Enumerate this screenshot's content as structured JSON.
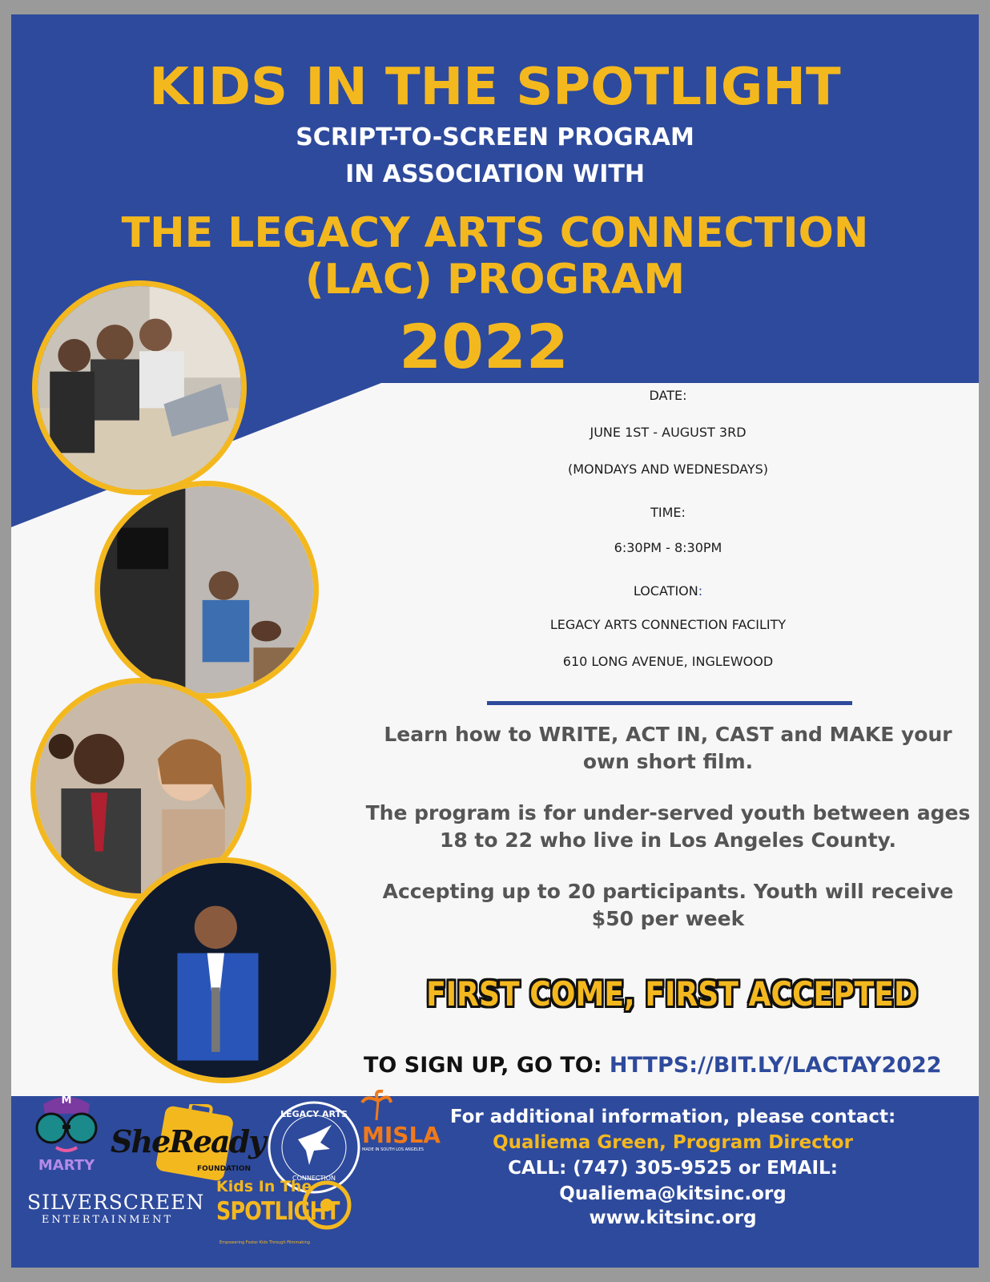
{
  "header": {
    "title": "KIDS IN THE SPOTLIGHT",
    "subtitle_line1": "SCRIPT-TO-SCREEN PROGRAM",
    "subtitle_line2": "IN ASSOCIATION WITH",
    "program_line1": "THE LEGACY ARTS CONNECTION",
    "program_line2": "(LAC) PROGRAM",
    "year": "2022"
  },
  "details": {
    "date_label": "DATE:",
    "date_value": "JUNE 1ST - AUGUST 3RD",
    "date_days": "(MONDAYS AND WEDNESDAYS)",
    "time_label": "TIME:",
    "time_value": "6:30PM - 8:30PM",
    "location_label": "LOCATION",
    "location_colon": ":",
    "location_line1": "LEGACY ARTS CONNECTION FACILITY",
    "location_line2": "610 LONG AVENUE, INGLEWOOD"
  },
  "description": {
    "para1_line1": "Learn how to WRITE, ACT IN, CAST and MAKE  your",
    "para1_line2": "own short film.",
    "para2_line1": "The program is for under-served youth between ages",
    "para2_line2": "18 to 22 who live in Los Angeles County.",
    "para3_line1": "Accepting up to 20 participants.  Youth will receive",
    "para3_line2": "$50 per week"
  },
  "callout": "FIRST COME, FIRST ACCEPTED",
  "signup": {
    "label": "TO SIGN UP, GO TO: ",
    "url": "HTTPS://BIT.LY/LACTAY2022"
  },
  "contact": {
    "line1": "For additional information, please contact:",
    "line2": "Qualiema Green, Program Director",
    "line3": "CALL: (747) 305-9525 or EMAIL:  Qualiema@kitsinc.org",
    "website": "www.kitsinc.org"
  },
  "logos": {
    "marty": "MARTY",
    "marty_badge": "M",
    "sheready": "SheReady",
    "sheready_sub": "FOUNDATION",
    "legacy_arts": "LEGACY ARTS",
    "legacy_connection": "CONNECTION",
    "misla": "MISLA",
    "misla_sub": "MADE IN SOUTH LOS ANGELES",
    "silverscreen": "SILVERSCREEN",
    "silverscreen_sub": "ENTERTAINMENT",
    "kits_top": "Kids In The",
    "kits_bottom": "SPOTLIGHT",
    "kits_tag": "Empowering Foster Kids Through Filmmaking"
  },
  "colors": {
    "brand_blue": "#2e4a9c",
    "accent_yellow": "#f4b81f",
    "background_white": "#f7f7f7"
  }
}
